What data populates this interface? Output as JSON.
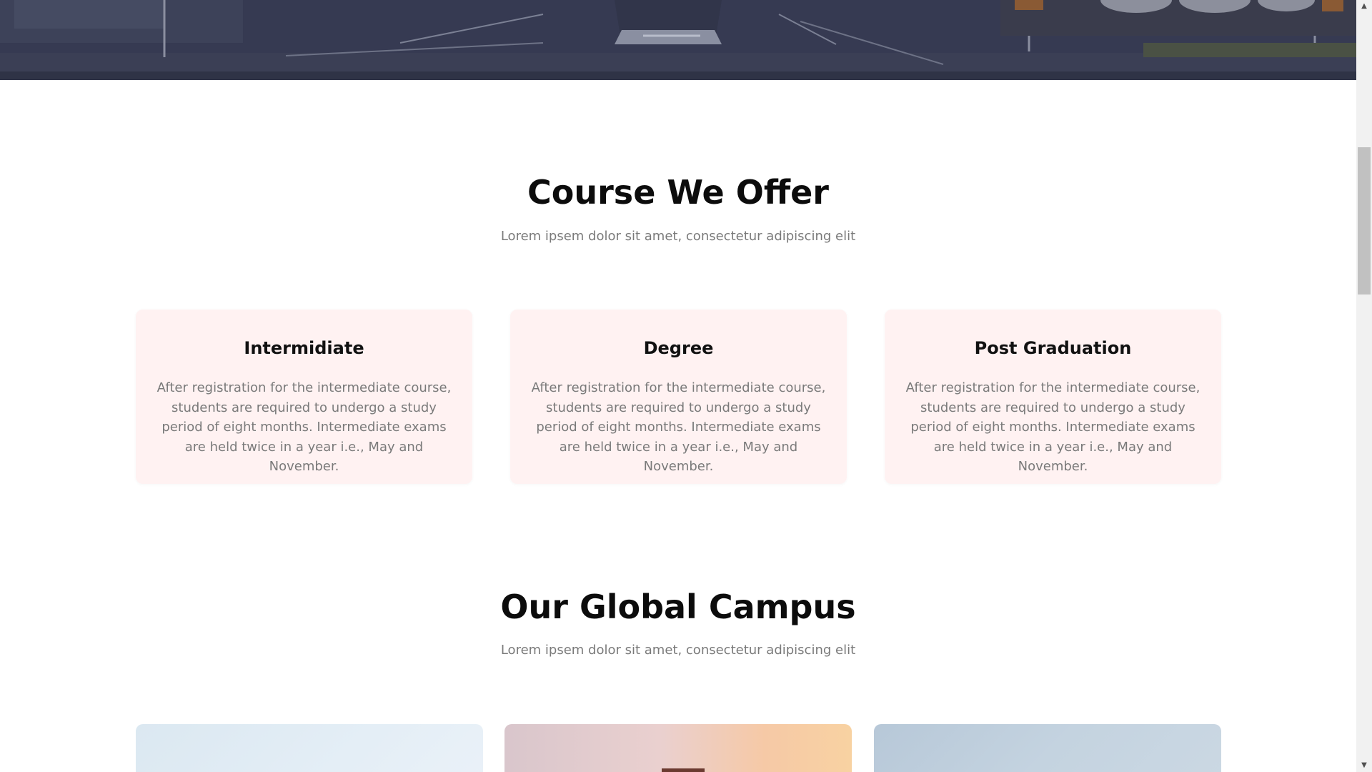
{
  "courses_section": {
    "title": "Course We Offer",
    "subtitle": "Lorem ipsem dolor sit amet, consectetur adipiscing elit",
    "cards": [
      {
        "title": "Intermidiate",
        "description": "After registration for the intermediate course, students are required to undergo a study period of eight months. Intermediate exams are held twice in a year i.e., May and November."
      },
      {
        "title": "Degree",
        "description": "After registration for the intermediate course, students are required to undergo a study period of eight months. Intermediate exams are held twice in a year i.e., May and November."
      },
      {
        "title": "Post Graduation",
        "description": "After registration for the intermediate course, students are required to undergo a study period of eight months. Intermediate exams are held twice in a year i.e., May and November."
      }
    ]
  },
  "campus_section": {
    "title": "Our Global Campus",
    "subtitle": "Lorem ipsem dolor sit amet, consectetur adipiscing elit"
  },
  "colors": {
    "card_background": "#fff2f2",
    "heading": "#0c0c0c",
    "body_text": "#7a7a7a",
    "hero_overlay": "#2b2f45"
  },
  "icons": {
    "scroll_up": "triangle-up-icon",
    "scroll_down": "triangle-down-icon"
  }
}
